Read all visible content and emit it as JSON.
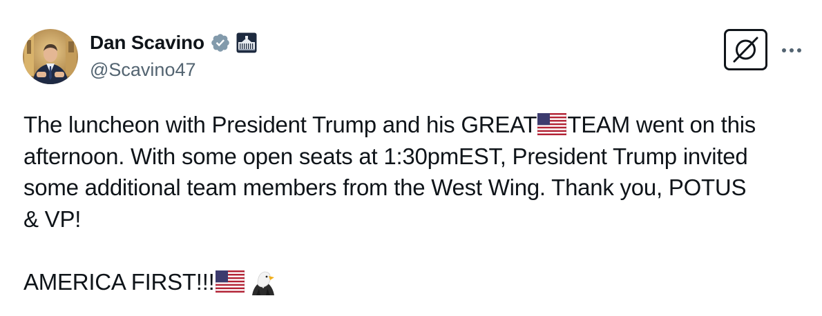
{
  "author": {
    "display_name": "Dan Scavino",
    "handle": "@Scavino47",
    "verified_badge": "verified-checkmark-icon",
    "affiliation_badge": "white-house-icon"
  },
  "actions": {
    "grok_icon": "grok-icon",
    "more_icon": "more-dots-icon"
  },
  "post": {
    "line1_a": "The luncheon with President Trump and his GREAT",
    "line1_b": "TEAM went on this",
    "line2": "afternoon. With some open seats at 1:30pmEST, President Trump invited",
    "line3": "some additional team members from the West Wing. Thank you, POTUS",
    "line4": "& VP!",
    "closing": "AMERICA FIRST!!!",
    "emojis": [
      "us-flag-icon",
      "us-flag-icon",
      "eagle-icon"
    ]
  },
  "colors": {
    "text": "#0f1419",
    "secondary_text": "#536471",
    "verified_badge": "#829aab"
  }
}
